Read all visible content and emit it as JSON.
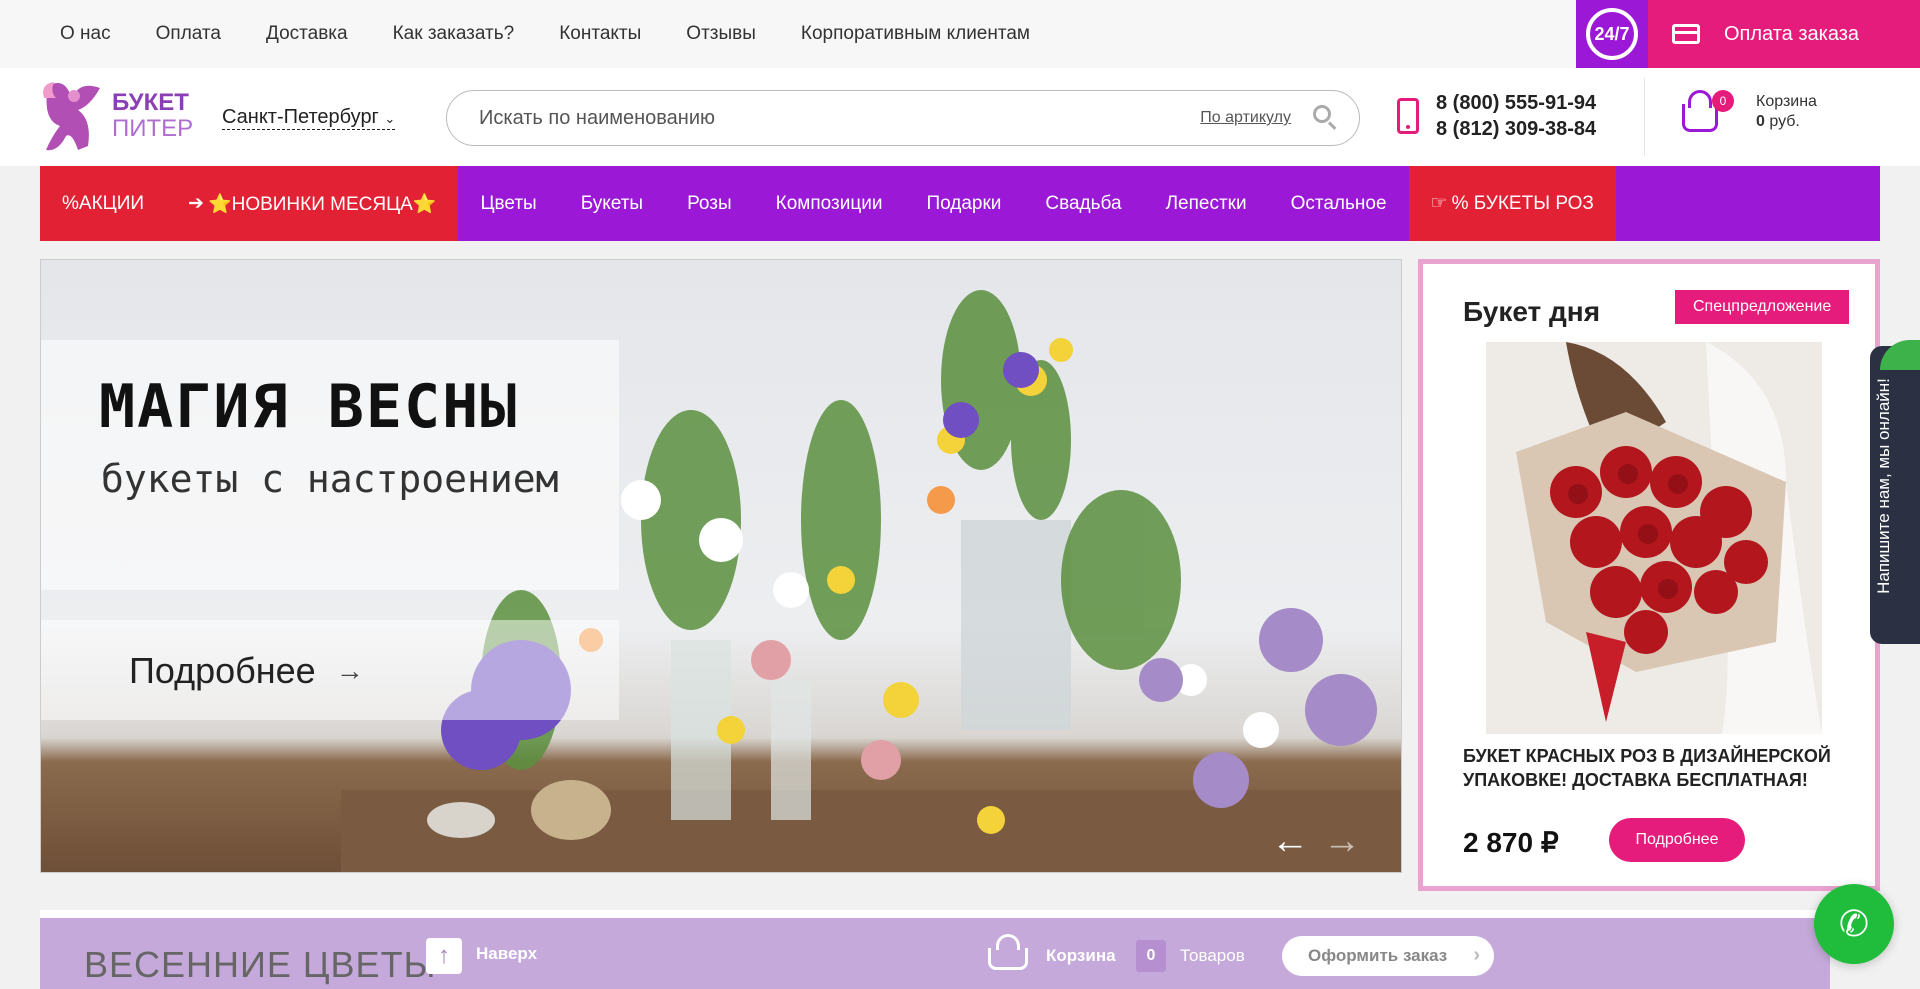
{
  "topnav": {
    "items": [
      "О нас",
      "Оплата",
      "Доставка",
      "Как заказать?",
      "Контакты",
      "Отзывы",
      "Корпоративным клиентам"
    ],
    "badge": "24/7",
    "pay_label": "Оплата заказа"
  },
  "header": {
    "logo_line1": "БУКЕТ",
    "logo_line2": "ПИТЕР",
    "city": "Санкт-Петербург",
    "search_placeholder": "Искать по наименованию",
    "search_article": "По артикулу",
    "phone1": "8 (800) 555-91-94",
    "phone2": "8 (812) 309-38-84",
    "cart_count": "0",
    "cart_label": "Корзина",
    "cart_sum": "0",
    "cart_currency": " руб."
  },
  "mainnav": {
    "promo": "%АКЦИИ",
    "new": "⭐НОВИНКИ МЕСЯЦА⭐",
    "items": [
      "Цветы",
      "Букеты",
      "Розы",
      "Композиции",
      "Подарки",
      "Свадьба",
      "Лепестки",
      "Остальное"
    ],
    "rose_promo": "% БУКЕТЫ РОЗ"
  },
  "banner": {
    "title": "МАГИЯ ВЕСНЫ",
    "subtitle": "букеты с настроением",
    "more": "Подробнее",
    "prev": "←",
    "next": "→"
  },
  "bouquet_day": {
    "title": "Букет дня",
    "tag": "Спецпредложение",
    "name": "БУКЕТ КРАСНЫХ РОЗ В ДИЗАЙНЕРСКОЙ УПАКОВКЕ! ДОСТАВКА БЕСПЛАТНАЯ!",
    "price": "2 870 ₽",
    "button": "Подробнее"
  },
  "chat": {
    "label": "Напишите нам, мы онлайн!"
  },
  "bottom": {
    "section_title": "ВЕСЕННИЕ ЦВЕТЫ",
    "up_label": "Наверх",
    "cart_label": "Корзина",
    "cart_count": "0",
    "goods_label": "Товаров",
    "order_label": "Оформить заказ"
  },
  "colors": {
    "brand_purple": "#9b19d6",
    "brand_pink": "#e61c7c",
    "promo_red": "#e32135",
    "call_green": "#1fbd3b"
  }
}
